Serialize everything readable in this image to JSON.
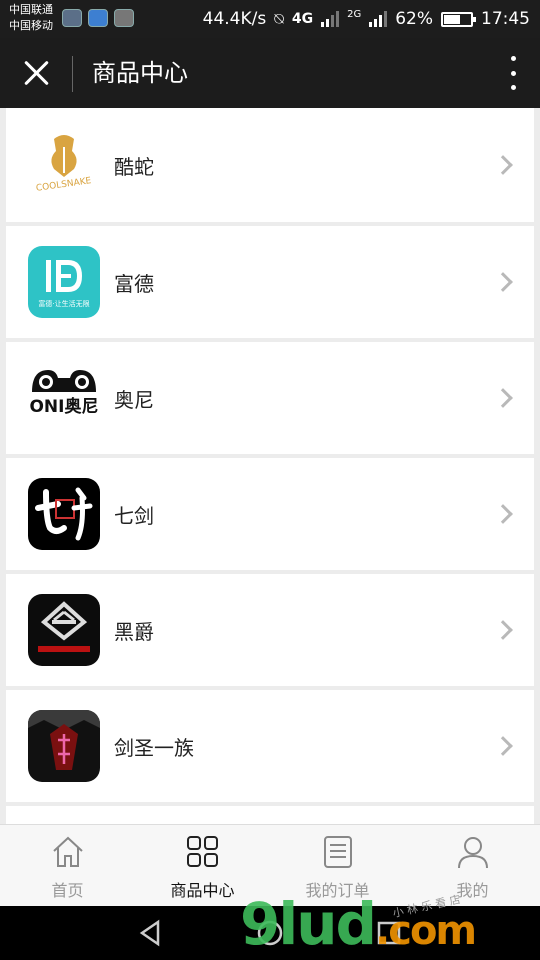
{
  "status_bar": {
    "carrier1": "中国联通",
    "carrier2": "中国移动",
    "net_speed": "44.4K/s",
    "net_4g": "4G",
    "net_2g": "2G",
    "battery": "62%",
    "battery_level": 0.62,
    "time": "17:45"
  },
  "header": {
    "title": "商品中心"
  },
  "items": [
    {
      "name": "酷蛇",
      "icon": "coolsnake-logo",
      "logo_text": "COOLSNAKE"
    },
    {
      "name": "富德",
      "icon": "fude-logo",
      "logo_text": "富德·让生活无限"
    },
    {
      "name": "奥尼",
      "icon": "aoni-logo",
      "logo_text": "ONI奥尼"
    },
    {
      "name": "七剑",
      "icon": "qijian-logo"
    },
    {
      "name": "黑爵",
      "icon": "heijue-logo"
    },
    {
      "name": "剑圣一族",
      "icon": "jianshengyizu-logo"
    }
  ],
  "tabs": [
    {
      "label": "首页",
      "icon": "home-icon"
    },
    {
      "label": "商品中心",
      "icon": "grid-icon"
    },
    {
      "label": "我的订单",
      "icon": "order-list-icon"
    },
    {
      "label": "我的",
      "icon": "user-icon"
    }
  ],
  "watermark": {
    "main": "9lud",
    "suffix": ".com",
    "small": "小 林 乐 看 店"
  },
  "colors": {
    "header_bg": "#1c1c1c",
    "active_tab": "#111111",
    "inactive_tab": "#999999",
    "fude_teal": "#2ec3c6"
  }
}
